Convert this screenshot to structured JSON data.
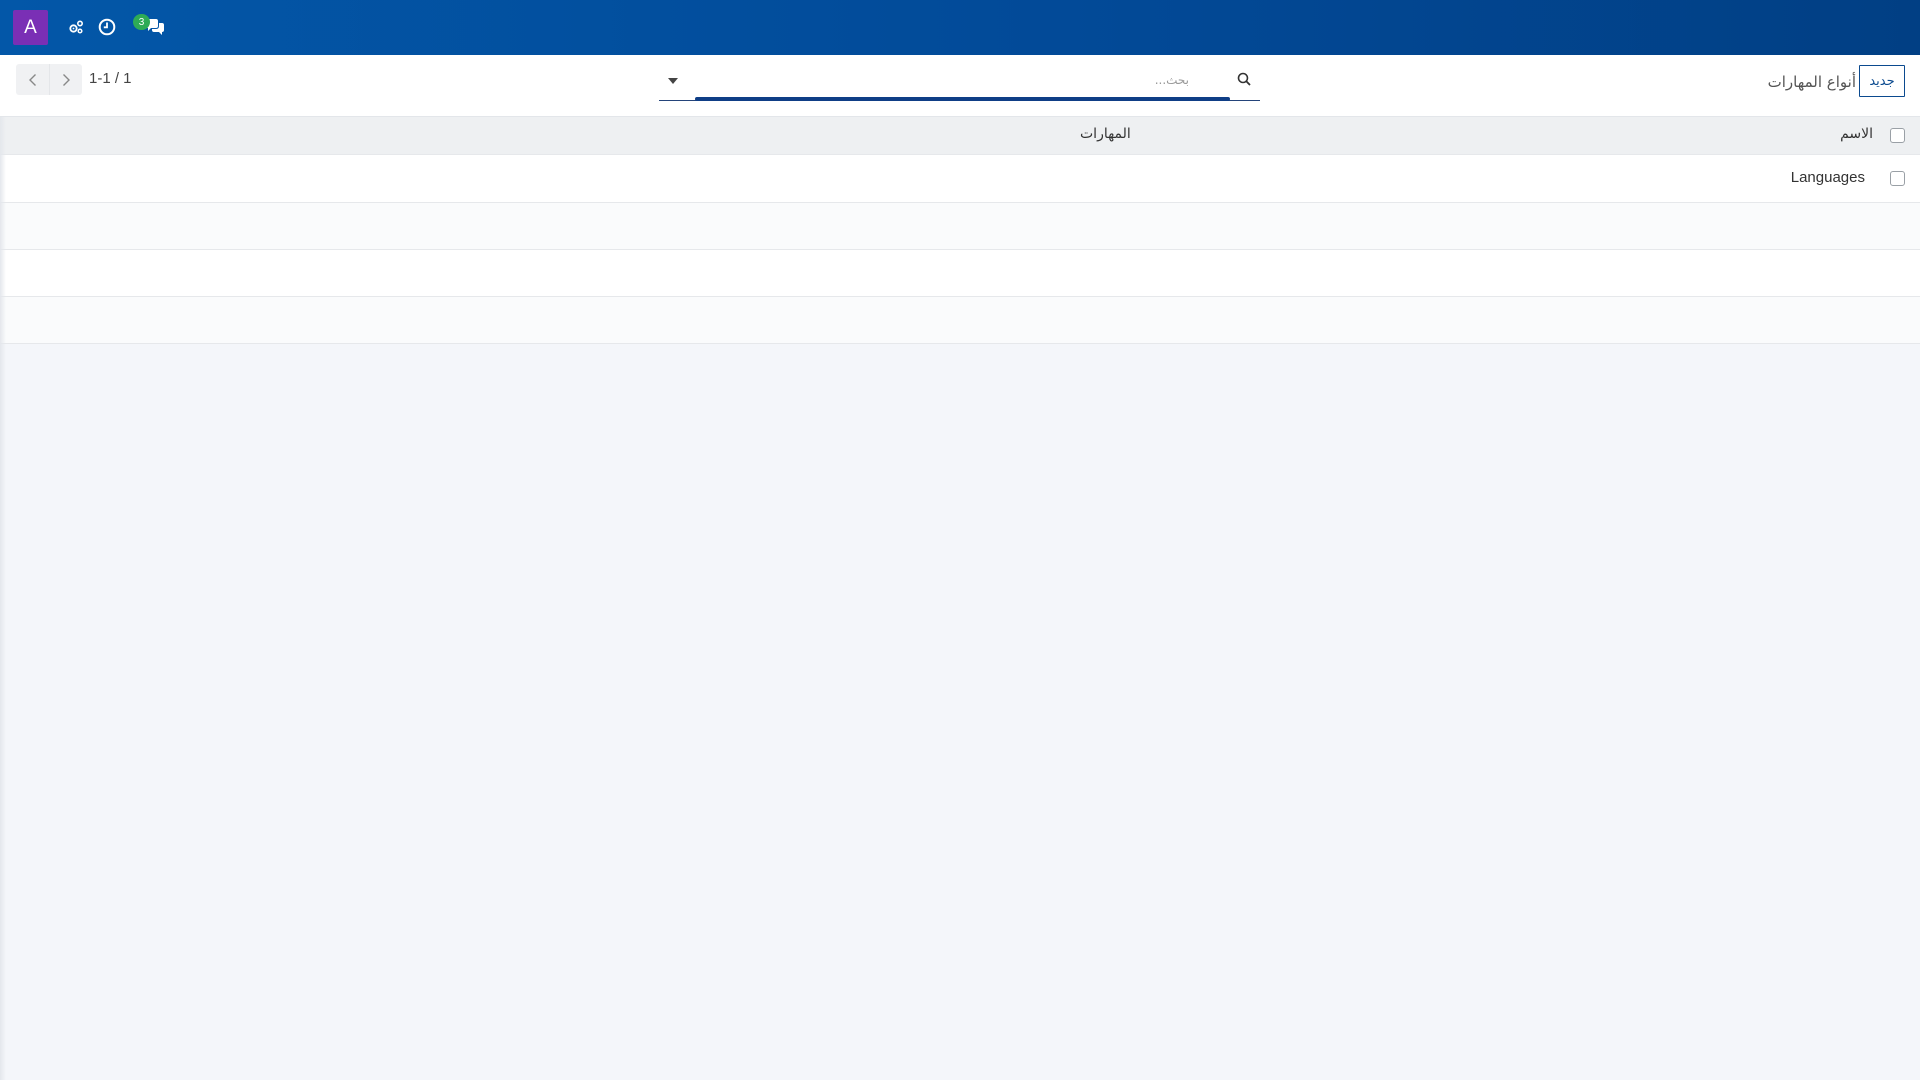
{
  "navbar": {
    "avatar_letter": "A",
    "chat_badge_count": "3",
    "icons": [
      "settings-icon",
      "clock-icon",
      "chat-icon"
    ],
    "background_color": "#0357a8"
  },
  "pager": {
    "value": "1-1 / 1"
  },
  "search": {
    "placeholder": "بحث..."
  },
  "breadcrumb": {
    "title": "أنواع المهارات"
  },
  "actions": {
    "new_label": "جديد"
  },
  "table": {
    "columns": {
      "name": "الاسم",
      "skills": "المهارات"
    },
    "rows": [
      {
        "name": "Languages",
        "skills": ""
      }
    ]
  },
  "colors": {
    "avatar": "#7a2fb5",
    "badge": "#2eab56",
    "primary": "#0b4a8f"
  }
}
